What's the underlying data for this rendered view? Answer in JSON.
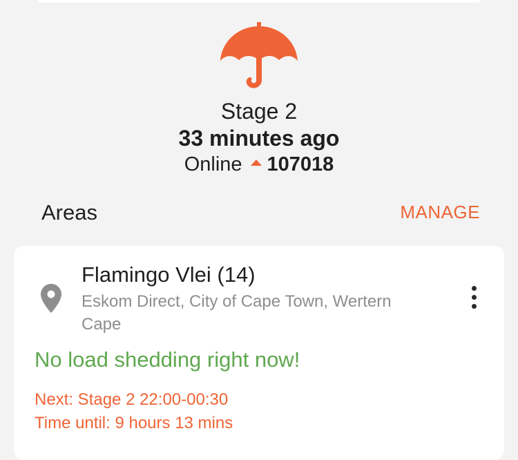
{
  "colors": {
    "accent": "#ee6436",
    "success": "#5fa84f",
    "muted_text": "#8e8e8e"
  },
  "status": {
    "icon": "umbrella-icon",
    "stage": "Stage 2",
    "updated": "33 minutes ago",
    "online_label": "Online",
    "online_trend_icon": "arrow-up-icon",
    "online_count": "107018"
  },
  "areas": {
    "title": "Areas",
    "manage_label": "MANAGE",
    "items": [
      {
        "icon": "location-pin-icon",
        "name": "Flamingo Vlei (14)",
        "provider": "Eskom Direct, City of Cape Town, Wertern Cape",
        "status": "No load shedding right now!",
        "next": "Next: Stage 2 22:00-00:30",
        "time_until": "Time until: 9 hours 13 mins",
        "menu_icon": "more-vertical-icon"
      }
    ]
  }
}
